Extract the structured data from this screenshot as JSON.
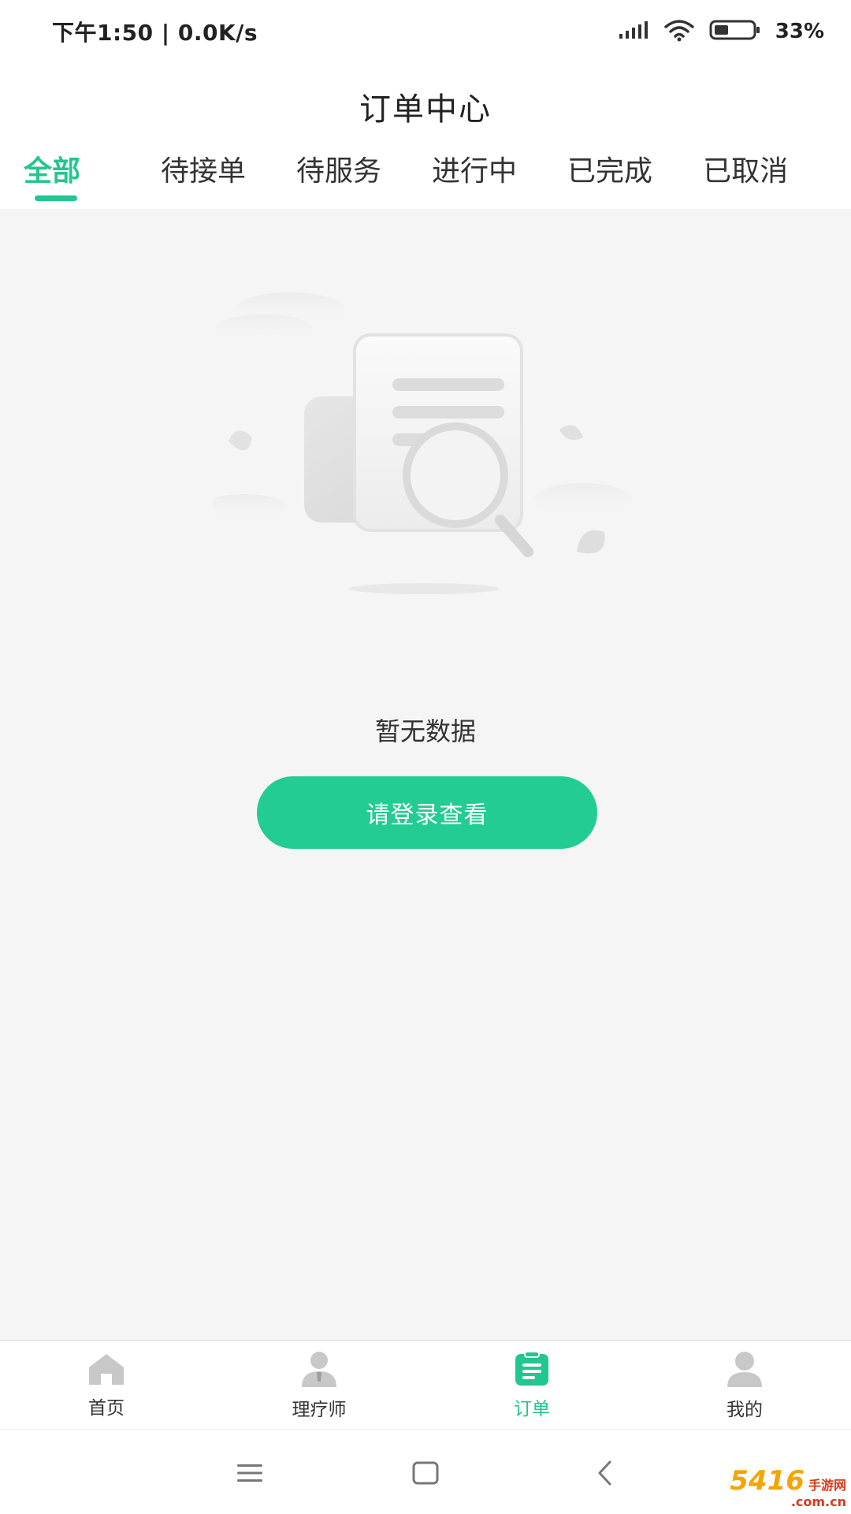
{
  "status_bar": {
    "time_speed": "下午1:50 | 0.0K/s",
    "battery_percent": "33%",
    "icons": [
      "signal-icon",
      "wifi-icon",
      "battery-icon"
    ]
  },
  "header": {
    "title": "订单中心"
  },
  "tabs": [
    {
      "label": "全部",
      "active": true
    },
    {
      "label": "待接单",
      "active": false
    },
    {
      "label": "待服务",
      "active": false
    },
    {
      "label": "进行中",
      "active": false
    },
    {
      "label": "已完成",
      "active": false
    },
    {
      "label": "已取消",
      "active": false
    }
  ],
  "empty_state": {
    "illustration": "empty-document-search-icon",
    "message": "暂无数据",
    "button_label": "请登录查看"
  },
  "bottom_nav": [
    {
      "label": "首页",
      "icon": "home-icon",
      "active": false
    },
    {
      "label": "理疗师",
      "icon": "therapist-icon",
      "active": false
    },
    {
      "label": "订单",
      "icon": "order-icon",
      "active": true
    },
    {
      "label": "我的",
      "icon": "profile-icon",
      "active": false
    }
  ],
  "system_nav": {
    "icons": [
      "menu-icon",
      "home-square-icon",
      "back-icon"
    ]
  },
  "watermark": {
    "main": "5416",
    "side": "手游网",
    "sub": ".com.cn"
  },
  "colors": {
    "accent": "#22c68e",
    "button": "#22cc92",
    "background": "#f5f5f5"
  }
}
